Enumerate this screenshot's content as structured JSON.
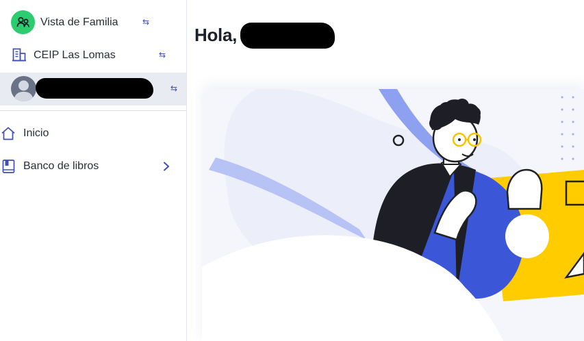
{
  "sidebar": {
    "family_view": {
      "label": "Vista de Familia",
      "icon": "family-icon",
      "swap_icon": "swap-icon"
    },
    "school": {
      "label": "CEIP Las Lomas",
      "icon": "building-icon",
      "swap_icon": "swap-icon"
    },
    "user": {
      "icon": "user-avatar",
      "swap_icon": "swap-icon"
    },
    "swap_glyph": "⇆",
    "nav": [
      {
        "label": "Inicio",
        "icon": "home-icon"
      },
      {
        "label": "Banco de libros",
        "icon": "book-icon",
        "chevron": "chevron-right-icon"
      }
    ]
  },
  "main": {
    "greeting": "Hola,"
  },
  "colors": {
    "accent": "#3f4fb8",
    "family_green": "#2ecc71",
    "hero_blue": "#3b57d8",
    "hero_yellow": "#ffcc00",
    "selected_row_bg": "#e8ebf2"
  }
}
